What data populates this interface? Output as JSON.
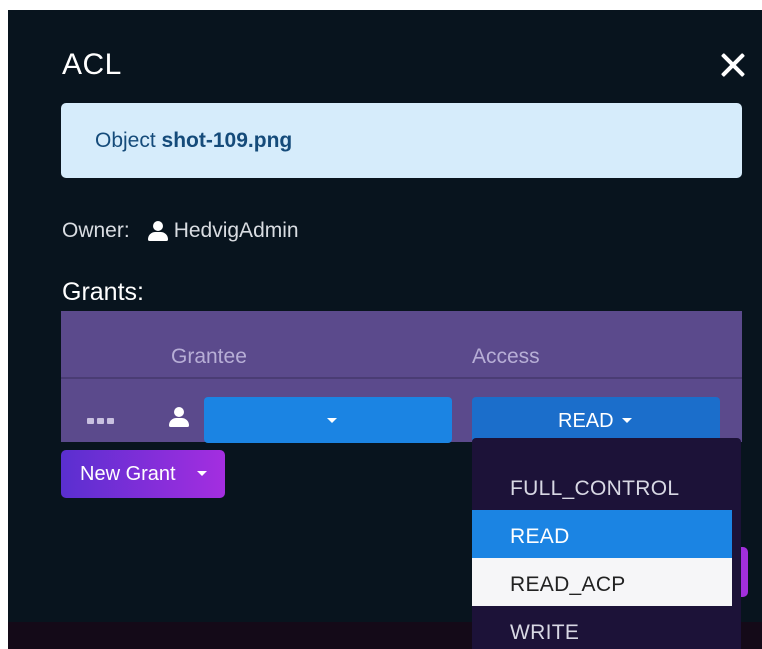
{
  "dialog": {
    "title": "ACL"
  },
  "banner": {
    "prefix": "Object",
    "filename": "shot-109.png"
  },
  "owner": {
    "label": "Owner:",
    "name": "HedvigAdmin"
  },
  "grants": {
    "label": "Grants:",
    "columns": [
      "Grantee",
      "Access"
    ],
    "rows": [
      {
        "grantee": "",
        "access": "READ"
      }
    ]
  },
  "actions": {
    "new_grant_label": "New Grant"
  },
  "access_menu": {
    "options": [
      "FULL_CONTROL",
      "READ",
      "READ_ACP",
      "WRITE"
    ],
    "selected": "READ",
    "hovered": "READ_ACP"
  },
  "colors": {
    "background": "#08141e",
    "banner_bg": "#d6ecfb",
    "banner_text": "#154b7a",
    "table_bg": "#5b4a8c",
    "primary_blue": "#1b84e3",
    "new_grant_gradient_start": "#5a2fd0",
    "new_grant_gradient_end": "#a42ee0",
    "menu_bg": "#1c1238"
  },
  "icons": {
    "close": "close-icon",
    "user": "user-icon",
    "row_menu": "more-dots-icon",
    "dropdown_caret": "chevron-down-icon"
  }
}
